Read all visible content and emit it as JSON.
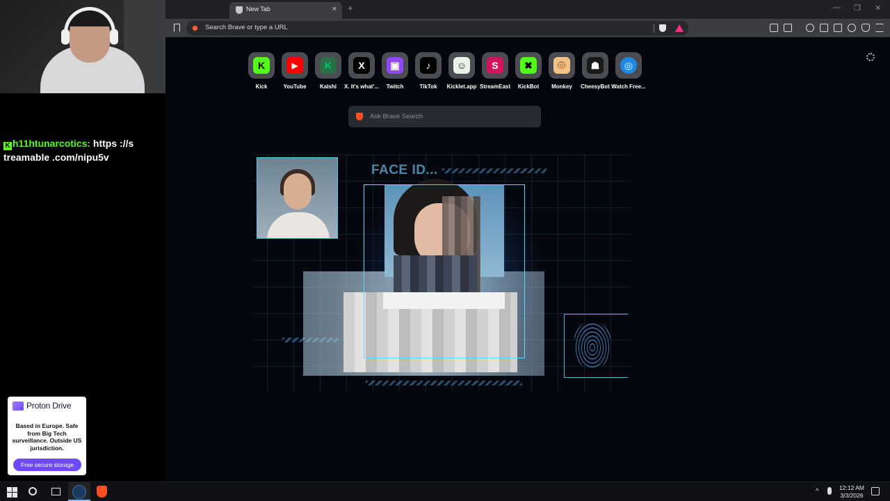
{
  "stream": {
    "chat_user": "h11htunarcotics:",
    "chat_message": "https ://s treamable .com/nipu5v",
    "ad": {
      "brand": "Proton Drive",
      "text": "Based in Europe. Safe from Big Tech surveillance. Outside US jurisdiction.",
      "button": "Free secure storage"
    }
  },
  "browser": {
    "tab_title": "New Tab",
    "tab_close": "×",
    "new_tab": "+",
    "url_placeholder": "Search Brave or type a URL",
    "search_placeholder": "Ask Brave Search",
    "window_controls": {
      "minimize": "—",
      "restore": "❐",
      "close": "✕"
    },
    "top_sites": [
      {
        "label": "Kick",
        "glyph": "K",
        "color": "#53fc18",
        "fg": "#000000"
      },
      {
        "label": "YouTube",
        "glyph": "▶",
        "color": "#ff0000",
        "fg": "#ffffff"
      },
      {
        "label": "Kalshi",
        "glyph": "K",
        "color": "#2a6f4a",
        "fg": "#00c46a"
      },
      {
        "label": "X. It's what'...",
        "glyph": "X",
        "color": "#000000",
        "fg": "#ffffff"
      },
      {
        "label": "Twitch",
        "glyph": "▣",
        "color": "#9146ff",
        "fg": "#ffffff"
      },
      {
        "label": "TikTok",
        "glyph": "♪",
        "color": "#000000",
        "fg": "#ffffff"
      },
      {
        "label": "Kicklet.app",
        "glyph": "☺",
        "color": "#e8f5e8",
        "fg": "#111111"
      },
      {
        "label": "StreamEast",
        "glyph": "S",
        "color": "#d4135c",
        "fg": "#ffffff"
      },
      {
        "label": "KickBot",
        "glyph": "✖",
        "color": "#53fc18",
        "fg": "#000000"
      },
      {
        "label": "Monkey",
        "glyph": "🐵",
        "color": "#f2c48a",
        "fg": "#4a2b10"
      },
      {
        "label": "CheesyBot",
        "glyph": "☗",
        "color": "#1a1a1a",
        "fg": "#ffffff"
      },
      {
        "label": "Watch Free...",
        "glyph": "◎",
        "color": "#1e88e5",
        "fg": "#9ad7ff"
      }
    ],
    "hero_title": "FACE ID..."
  },
  "taskbar": {
    "time": "12:12 AM",
    "date": "3/3/2026",
    "tray_arrow": "^"
  }
}
